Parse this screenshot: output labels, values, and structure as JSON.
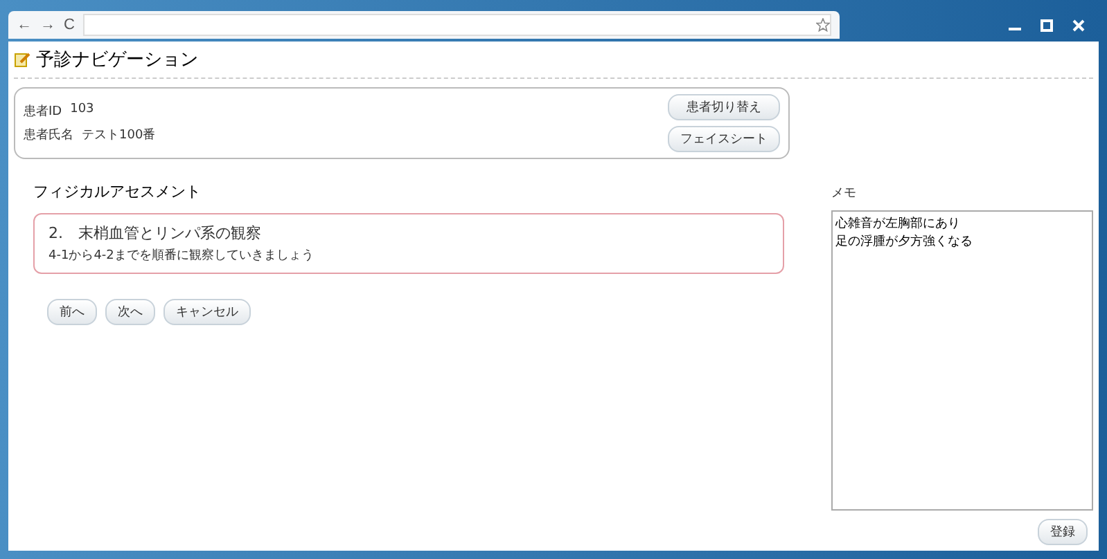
{
  "browser": {
    "nav": [
      "←",
      "→",
      "C"
    ]
  },
  "app": {
    "title": "予診ナビゲーション"
  },
  "patient": {
    "id_label": "患者ID",
    "id": "103",
    "name_label": "患者氏名",
    "name": "テスト100番",
    "buttons": [
      "患者切り替え",
      "フェイスシート"
    ]
  },
  "assessment": {
    "heading": "フィジカルアセスメント",
    "step": "2.　末梢血管とリンパ系の観察",
    "instruction": "4-1から4-2までを順番に観察していきましょう",
    "buttons": [
      "前へ",
      "次へ",
      "キャンセル"
    ]
  },
  "memo": {
    "label": "メモ",
    "lines": [
      "心雑音が左胸部にあり",
      "足の浮腫が夕方強くなる"
    ],
    "button": "登録"
  }
}
